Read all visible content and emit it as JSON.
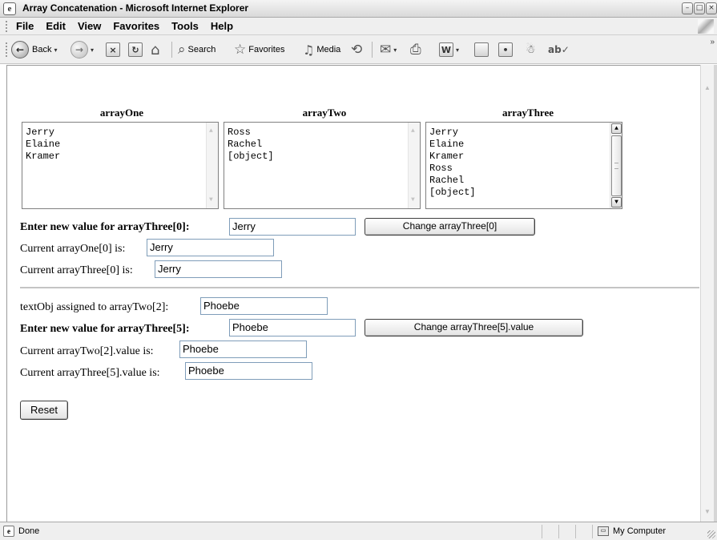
{
  "window": {
    "title": "Array Concatenation - Microsoft Internet Explorer",
    "buttons": [
      "minimize",
      "maximize",
      "close"
    ]
  },
  "menu": [
    "File",
    "Edit",
    "View",
    "Favorites",
    "Tools",
    "Help"
  ],
  "toolbar": {
    "back_label": "Back",
    "search_label": "Search",
    "favorites_label": "Favorites",
    "media_label": "Media",
    "back_icon": "←",
    "forward_icon": "→",
    "stop_icon": "×",
    "refresh_icon": "↻",
    "home_icon": "⌂",
    "search_icon": "⌕",
    "favorites_icon": "☆",
    "media_icon": "♫",
    "history_icon": "⟲",
    "mail_icon": "✉",
    "print_icon": "⎙",
    "edit_icon": "W",
    "dropdown_icon": "▾",
    "overflow_icon": "»"
  },
  "page": {
    "arrays": {
      "one": {
        "heading": "arrayOne",
        "items": [
          "Jerry",
          "Elaine",
          "Kramer"
        ]
      },
      "two": {
        "heading": "arrayTwo",
        "items": [
          "Ross",
          "Rachel",
          "[object]"
        ]
      },
      "three": {
        "heading": "arrayThree",
        "items": [
          "Jerry",
          "Elaine",
          "Kramer",
          "Ross",
          "Rachel",
          "[object]"
        ]
      }
    },
    "section1": {
      "new_value_label": "Enter new value for arrayThree[0]:",
      "new_value": "Jerry",
      "change_button": "Change arrayThree[0]",
      "current_one_label": "Current arrayOne[0] is:",
      "current_one_value": "Jerry",
      "current_three_label": "Current arrayThree[0] is:",
      "current_three_value": "Jerry"
    },
    "section2": {
      "textobj_label": "textObj assigned to arrayTwo[2]:",
      "textobj_value": "Phoebe",
      "new_value_label": "Enter new value for arrayThree[5]:",
      "new_value": "Phoebe",
      "change_button": "Change arrayThree[5].value",
      "current_two_label": "Current arrayTwo[2].value is:",
      "current_two_value": "Phoebe",
      "current_three_label": "Current arrayThree[5].value is:",
      "current_three_value": "Phoebe"
    },
    "reset_button": "Reset"
  },
  "status": {
    "text": "Done",
    "zone": "My Computer"
  }
}
